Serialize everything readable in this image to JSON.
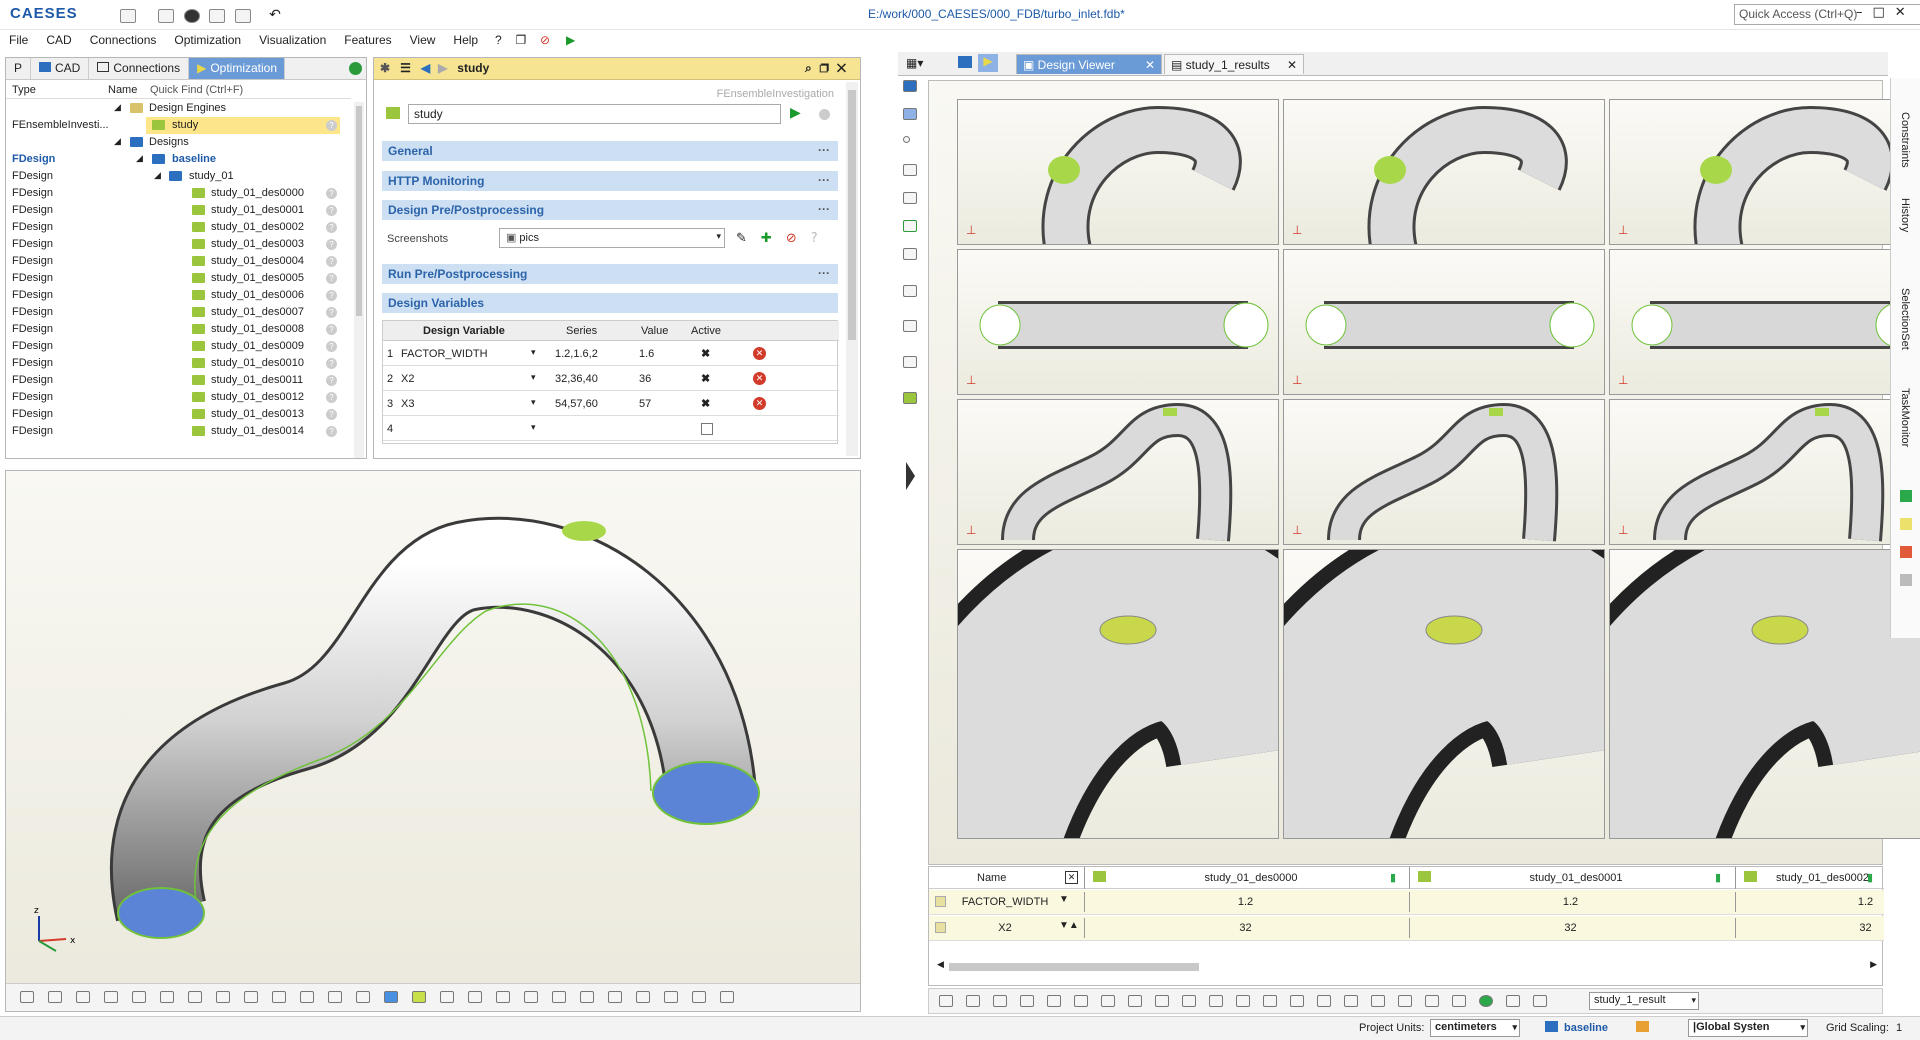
{
  "app": {
    "logo": "CAESES",
    "title": "E:/work/000_CAESES/000_FDB/turbo_inlet.fdb*",
    "quick_access": "Quick Access (Ctrl+Q)"
  },
  "menu": [
    "File",
    "CAD",
    "Connections",
    "Optimization",
    "Visualization",
    "Features",
    "View",
    "Help"
  ],
  "left_tabs": {
    "p": "P",
    "cad": "CAD",
    "connections": "Connections",
    "optimization": "Optimization"
  },
  "tree": {
    "col_type": "Type",
    "col_name": "Name",
    "quick_find": "Quick Find (Ctrl+F)",
    "design_engines": "Design Engines",
    "engine_type": "FEnsembleInvesti...",
    "engine_name": "study",
    "designs": "Designs",
    "baseline_type": "FDesign",
    "baseline": "baseline",
    "study_type": "FDesign",
    "study": "study_01",
    "items_type": "FDesign",
    "items": [
      "study_01_des0000",
      "study_01_des0001",
      "study_01_des0002",
      "study_01_des0003",
      "study_01_des0004",
      "study_01_des0005",
      "study_01_des0006",
      "study_01_des0007",
      "study_01_des0008",
      "study_01_des0009",
      "study_01_des0010",
      "study_01_des0011",
      "study_01_des0012",
      "study_01_des0013",
      "study_01_des0014"
    ]
  },
  "editor": {
    "header": "study",
    "type_label": "FEnsembleInvestigation",
    "name_value": "study",
    "sections": {
      "general": "General",
      "http": "HTTP Monitoring",
      "design_pre": "Design Pre/Postprocessing",
      "run_pre": "Run Pre/Postprocessing",
      "design_vars": "Design Variables"
    },
    "screenshots_label": "Screenshots",
    "screenshots_value": "pics",
    "table_headers": {
      "variable": "Design Variable",
      "series": "Series",
      "value": "Value",
      "active": "Active"
    },
    "rows": [
      {
        "num": "1",
        "name": "FACTOR_WIDTH",
        "series": "1.2,1.6,2",
        "value": "1.6"
      },
      {
        "num": "2",
        "name": "X2",
        "series": "32,36,40",
        "value": "36"
      },
      {
        "num": "3",
        "name": "X3",
        "series": "54,57,60",
        "value": "57"
      },
      {
        "num": "4",
        "name": "",
        "series": "",
        "value": ""
      }
    ]
  },
  "right_tabs": {
    "design_viewer": "Design Viewer",
    "results": "study_1_results"
  },
  "side_panels": [
    "Constraints",
    "History",
    "SelectionSet",
    "TaskMonitor"
  ],
  "results_table": {
    "name_header": "Name",
    "columns": [
      "study_01_des0000",
      "study_01_des0001",
      "study_01_des0002"
    ],
    "rows": [
      {
        "name": "FACTOR_WIDTH",
        "values": [
          "1.2",
          "1.2",
          "1.2"
        ]
      },
      {
        "name": "X2",
        "values": [
          "32",
          "32",
          "32"
        ]
      }
    ]
  },
  "results_combo": "study_1_result",
  "status": {
    "units_label": "Project Units:",
    "units": "centimeters",
    "design": "baseline",
    "coord": "|Global Systen",
    "grid_label": "Grid Scaling:",
    "grid_value": "1"
  },
  "colors": {
    "accent": "#6b9bd6",
    "section": "#cddff3",
    "highlight": "#fde68a",
    "green": "#9bc53d"
  }
}
